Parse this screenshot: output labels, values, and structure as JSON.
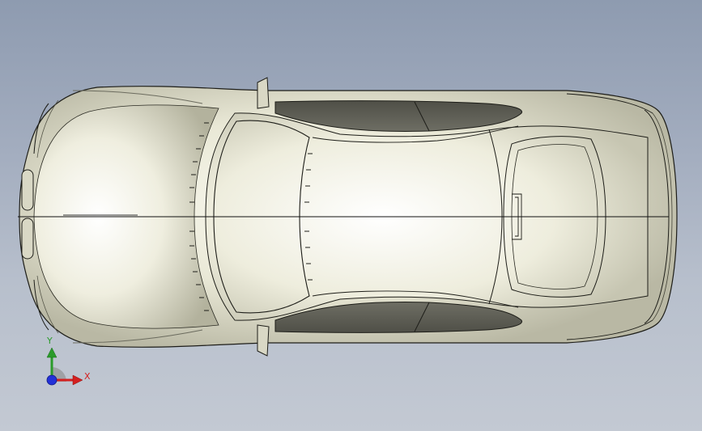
{
  "viewport": {
    "background_top": "#8e9bb0",
    "background_bottom": "#c3c9d3",
    "model": {
      "name": "car-top-view",
      "body_color": "#e7e6d4",
      "edge_color": "#1d1d18",
      "glass_color": "#5d5d54"
    }
  },
  "triad": {
    "x_label": "X",
    "y_label": "Y",
    "x_color": "#d42020",
    "y_color": "#2b9b2b",
    "z_color": "#2331d8"
  }
}
